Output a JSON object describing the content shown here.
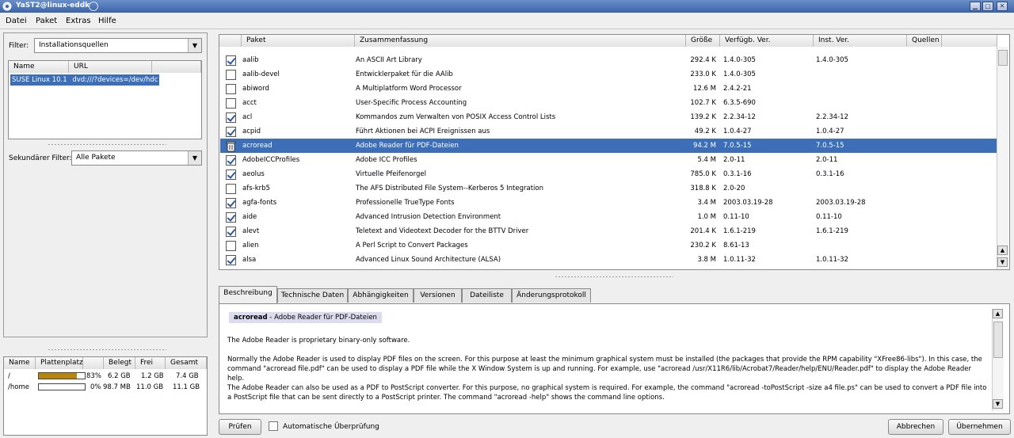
{
  "window": {
    "title": "YaST2@linux-eddk"
  },
  "menu": [
    "Datei",
    "Paket",
    "Extras",
    "Hilfe"
  ],
  "left": {
    "filter_label": "Filter:",
    "filter_value": "Installationsquellen",
    "sources_headers": [
      "Name",
      "URL"
    ],
    "sources": [
      {
        "name": "SUSE Linux 10.1",
        "url": "dvd:///?devices=/dev/hdc"
      }
    ],
    "secondary_label": "Sekundärer Filter:",
    "secondary_value": "Alle Pakete"
  },
  "disk": {
    "headers": [
      "Name",
      "Plattenplatz",
      "",
      "Belegt",
      "Frei",
      "Gesamt"
    ],
    "rows": [
      {
        "name": "/",
        "percent": "83%",
        "used": "6.2 GB",
        "free": "1.2 GB",
        "total": "7.4 GB",
        "fill": 0.83
      },
      {
        "name": "/home",
        "percent": "0%",
        "used": "98.7 MB",
        "free": "11.0 GB",
        "total": "11.1 GB",
        "fill": 0.0
      }
    ]
  },
  "table": {
    "headers": [
      "Paket",
      "Zusammenfassung",
      "Größe",
      "Verfügb. Ver.",
      "Inst. Ver.",
      "Quellen"
    ],
    "rows": [
      {
        "status": "checked",
        "name": "aalib",
        "summary": "An ASCII Art Library",
        "size": "292.4 K",
        "avail": "1.4.0-305",
        "inst": "1.4.0-305"
      },
      {
        "status": "empty",
        "name": "aalib-devel",
        "summary": "Entwicklerpaket für die AAlib",
        "size": "233.0 K",
        "avail": "1.4.0-305",
        "inst": ""
      },
      {
        "status": "empty",
        "name": "abiword",
        "summary": "A Multiplatform Word Processor",
        "size": "12.6 M",
        "avail": "2.4.2-21",
        "inst": ""
      },
      {
        "status": "empty",
        "name": "acct",
        "summary": "User-Specific Process Accounting",
        "size": "102.7 K",
        "avail": "6.3.5-690",
        "inst": ""
      },
      {
        "status": "checked",
        "name": "acl",
        "summary": "Kommandos zum Verwalten von POSIX Access Control Lists",
        "size": "139.2 K",
        "avail": "2.2.34-12",
        "inst": "2.2.34-12"
      },
      {
        "status": "checked",
        "name": "acpid",
        "summary": "Führt Aktionen bei ACPI Ereignissen aus",
        "size": "49.2 K",
        "avail": "1.0.4-27",
        "inst": "1.0.4-27"
      },
      {
        "status": "trash",
        "name": "acroread",
        "summary": "Adobe Reader für PDF-Dateien",
        "size": "94.2 M",
        "avail": "7.0.5-15",
        "inst": "7.0.5-15"
      },
      {
        "status": "checked",
        "name": "AdobeICCProfiles",
        "summary": "Adobe ICC Profiles",
        "size": "5.4 M",
        "avail": "2.0-11",
        "inst": "2.0-11"
      },
      {
        "status": "checked",
        "name": "aeolus",
        "summary": "Virtuelle Pfeifenorgel",
        "size": "785.0 K",
        "avail": "0.3.1-16",
        "inst": "0.3.1-16"
      },
      {
        "status": "empty",
        "name": "afs-krb5",
        "summary": "The AFS Distributed File System--Kerberos 5 Integration",
        "size": "318.8 K",
        "avail": "2.0-20",
        "inst": ""
      },
      {
        "status": "checked",
        "name": "agfa-fonts",
        "summary": "Professionelle TrueType Fonts",
        "size": "3.4 M",
        "avail": "2003.03.19-28",
        "inst": "2003.03.19-28"
      },
      {
        "status": "checked",
        "name": "aide",
        "summary": "Advanced Intrusion Detection Environment",
        "size": "1.0 M",
        "avail": "0.11-10",
        "inst": "0.11-10"
      },
      {
        "status": "checked",
        "name": "alevt",
        "summary": "Teletext and Videotext Decoder for the BTTV Driver",
        "size": "201.4 K",
        "avail": "1.6.1-219",
        "inst": "1.6.1-219"
      },
      {
        "status": "empty",
        "name": "alien",
        "summary": "A Perl Script to Convert Packages",
        "size": "230.2 K",
        "avail": "8.61-13",
        "inst": ""
      },
      {
        "status": "checked",
        "name": "alsa",
        "summary": "Advanced Linux Sound Architecture (ALSA)",
        "size": "3.8 M",
        "avail": "1.0.11-32",
        "inst": "1.0.11-32"
      }
    ]
  },
  "tabs": [
    "Beschreibung",
    "Technische Daten",
    "Abhängigkeiten",
    "Versionen",
    "Dateiliste",
    "Änderungsprotokoll"
  ],
  "description": {
    "title_name": "acroread",
    "title_rest": " - Adobe Reader für PDF-Dateien",
    "p1": "The Adobe Reader is proprietary binary-only software.",
    "p2": "Normally the Adobe Reader is used to display PDF files on the screen. For this purpose at least the minimum graphical system must be installed (the packages that provide the RPM capability \"XFree86-libs\"). In this case, the command \"acroread file.pdf\" can be used to display a PDF file while the X Window System is up and running. For example, use \"acroread /usr/X11R6/lib/Acrobat7/Reader/help/ENU/Reader.pdf\" to display the Adobe Reader help.",
    "p3": "The Adobe Reader can also be used as a PDF to PostScript converter. For this purpose, no graphical system is required. For example, the command \"acroread -toPostScript -size a4 file.ps\" can be used to convert a PDF file into a PostScript file that can be sent directly to a PostScript printer. The command \"acroread -help\" shows the command line options."
  },
  "bottom": {
    "check_button": "Prüfen",
    "auto_check_label": "Automatische Überprüfung",
    "cancel_button": "Abbrechen",
    "accept_button": "Übernehmen"
  }
}
